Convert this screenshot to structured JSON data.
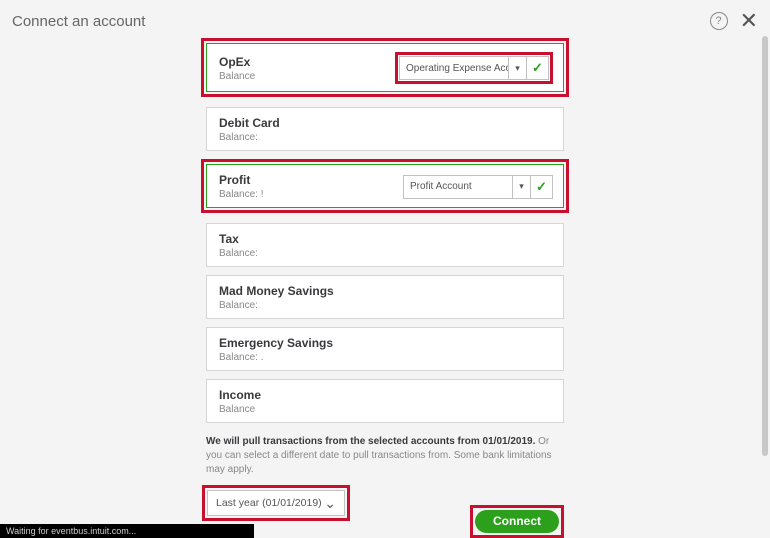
{
  "header": {
    "title": "Connect an account"
  },
  "accounts": [
    {
      "name": "OpEx",
      "balance": "Balance",
      "selected": true,
      "highlight": true,
      "dropdown": "Operating Expense Accou",
      "dropdownHighlight": true
    },
    {
      "name": "Debit Card",
      "balance": "Balance:",
      "selected": false,
      "highlight": false
    },
    {
      "name": "Profit",
      "balance": "Balance: !",
      "selected": true,
      "highlight": true,
      "dropdown": "Profit Account",
      "dropdownHighlight": false
    },
    {
      "name": "Tax",
      "balance": "Balance:",
      "selected": false,
      "highlight": false
    },
    {
      "name": "Mad Money Savings",
      "balance": "Balance:",
      "selected": false,
      "highlight": false
    },
    {
      "name": "Emergency Savings",
      "balance": "Balance: .",
      "selected": false,
      "highlight": false
    },
    {
      "name": "Income",
      "balance": "Balance",
      "selected": false,
      "highlight": false
    }
  ],
  "disclaimer": {
    "bold": "We will pull transactions from the selected accounts from 01/01/2019.",
    "light": " Or you can select a different date to pull transactions from. Some bank limitations may apply."
  },
  "dateSelect": "Last year (01/01/2019)",
  "connectLabel": "Connect",
  "statusBar": "Waiting for eventbus.intuit.com..."
}
